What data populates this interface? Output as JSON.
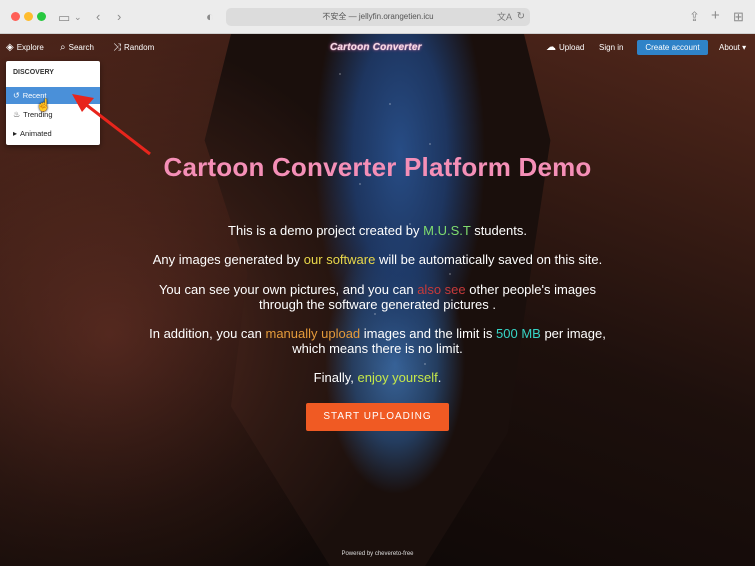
{
  "browser": {
    "url_text": "不安全 — jellyfin.orangetien.icu",
    "translate_icon": "translate-icon",
    "reload_icon": "reload-icon"
  },
  "nav": {
    "explore": "Explore",
    "search": "Search",
    "random": "Random",
    "brand": "Cartoon Converter",
    "upload": "Upload",
    "sign_in": "Sign in",
    "create_account": "Create account",
    "about": "About"
  },
  "dropdown": {
    "header": "DISCOVERY",
    "items": [
      {
        "label": "Recent",
        "icon": "history-icon",
        "active": true
      },
      {
        "label": "Trending",
        "icon": "flame-icon",
        "active": false
      },
      {
        "label": "Animated",
        "icon": "play-icon",
        "active": false
      }
    ]
  },
  "hero": {
    "title": "Cartoon Converter Platform Demo",
    "p1": {
      "a": "This is a demo project created by ",
      "b": "M.U.S.T",
      "c": " students."
    },
    "p2": {
      "a": "Any images generated by ",
      "b": "our software",
      "c": " will be automatically saved on this site."
    },
    "p3": {
      "a": "You can see your own pictures, and you can ",
      "b": "also see",
      "c": " other people's images",
      "d": "through the software generated pictures ."
    },
    "p4": {
      "a": "In addition, you can ",
      "b": "manually upload",
      "c": " images and the limit is ",
      "d": "500 MB",
      "e": " per image,",
      "f": "which means there is no limit."
    },
    "p5": {
      "a": "Finally, ",
      "b": "enjoy yourself",
      "c": "."
    },
    "cta": "START UPLOADING"
  },
  "footer": {
    "powered": "Powered by chevereto-free"
  },
  "colors": {
    "title": "#f58fb7",
    "cta": "#f05a23",
    "create_account": "#2f83c8",
    "dropdown_active": "#4a90d9"
  }
}
